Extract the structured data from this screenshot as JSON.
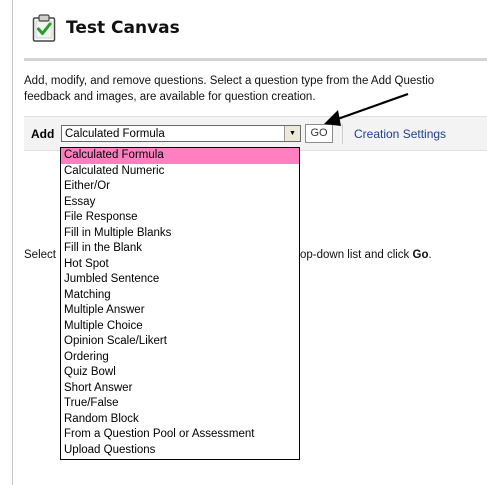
{
  "page": {
    "title": "Test Canvas",
    "icon": "clipboard-check-icon"
  },
  "instructions": {
    "line1": "Add, modify, and remove questions. Select a question type from the Add Questio",
    "line2": "feedback and images, are available for question creation."
  },
  "toolbar": {
    "add_label": "Add",
    "selected_type": "Calculated Formula",
    "go_label": "GO",
    "creation_settings_label": "Creation Settings"
  },
  "prompt": {
    "prefix": "Select",
    "suffix_before": "op-down list and click ",
    "suffix_bold": "Go",
    "suffix_after": "."
  },
  "dropdown": {
    "options": [
      "Calculated Formula",
      "Calculated Numeric",
      "Either/Or",
      "Essay",
      "File Response",
      "Fill in Multiple Blanks",
      "Fill in the Blank",
      "Hot Spot",
      "Jumbled Sentence",
      "Matching",
      "Multiple Answer",
      "Multiple Choice",
      "Opinion Scale/Likert",
      "Ordering",
      "Quiz Bowl",
      "Short Answer",
      "True/False",
      "Random Block",
      "From a Question Pool or Assessment",
      "Upload Questions"
    ],
    "selected_index": 0
  },
  "colors": {
    "highlight": "#ff7fc0",
    "link": "#1d3f8a",
    "toolbar_bg": "#f3f3f3"
  }
}
